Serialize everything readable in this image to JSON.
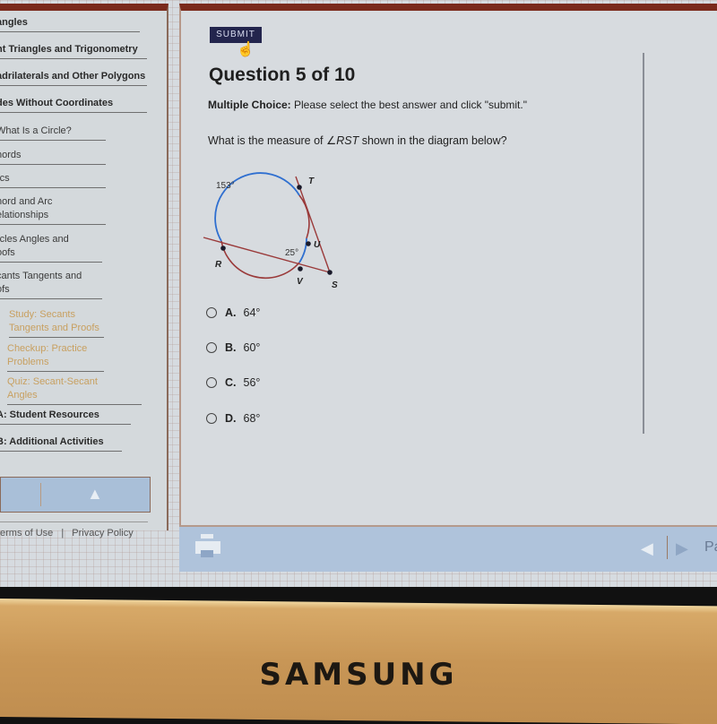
{
  "sidebar": {
    "items": [
      {
        "label": "angles",
        "level": "top"
      },
      {
        "label": "ht Triangles and Trigonometry",
        "level": "top"
      },
      {
        "label": "adrilaterals and Other Polygons",
        "level": "top"
      },
      {
        "label": "des Without Coordinates",
        "level": "top"
      },
      {
        "label": "What Is a Circle?",
        "level": "sub"
      },
      {
        "label": "hords",
        "level": "sub"
      },
      {
        "label": "rcs",
        "level": "sub"
      },
      {
        "label": "hord and Arc",
        "label2": "elationships",
        "level": "sub"
      },
      {
        "label": "rcles Angles and",
        "label2": "oofs",
        "level": "sub"
      },
      {
        "label": "cants Tangents and",
        "label2": "ofs",
        "level": "sub"
      },
      {
        "label": "Study: Secants",
        "label2": "Tangents and Proofs",
        "level": "deep"
      },
      {
        "label": "Checkup: Practice",
        "label2": "Problems",
        "level": "deep"
      },
      {
        "label": "Quiz: Secant-Secant",
        "label2": "Angles",
        "level": "deep"
      },
      {
        "label": "A: Student Resources",
        "level": "top"
      },
      {
        "label": "B: Additional Activities",
        "level": "top"
      }
    ],
    "up_icon": "arrow-up-icon",
    "footer": {
      "terms": "erms of Use",
      "separator": "|",
      "privacy": "Privacy Policy"
    }
  },
  "main": {
    "submit_label": "SUBMIT",
    "title": "Question 5 of 10",
    "instruction_bold": "Multiple Choice:",
    "instruction_text": " Please select the best answer and click \"submit.\"",
    "prompt_before": "What is the measure of ",
    "prompt_angle_symbol": "∠",
    "prompt_angle": "RST",
    "prompt_after": " shown in the diagram below?",
    "diagram": {
      "arc_large_label": "153°",
      "arc_small_label": "25°",
      "points": [
        "R",
        "T",
        "U",
        "V",
        "S"
      ],
      "colors": {
        "highlight_arc": "#2f6fd0",
        "secant": "#9a3a3a"
      }
    },
    "choices": [
      {
        "letter": "A.",
        "value": "64°"
      },
      {
        "letter": "B.",
        "value": "60°"
      },
      {
        "letter": "C.",
        "value": "56°"
      },
      {
        "letter": "D.",
        "value": "68°"
      }
    ]
  },
  "bottom_bar": {
    "print_icon": "printer-icon",
    "prev_icon": "arrow-left-icon",
    "next_icon": "arrow-right-icon",
    "page_label": "Pa"
  },
  "bezel": {
    "brand": "SAMSUNG"
  }
}
